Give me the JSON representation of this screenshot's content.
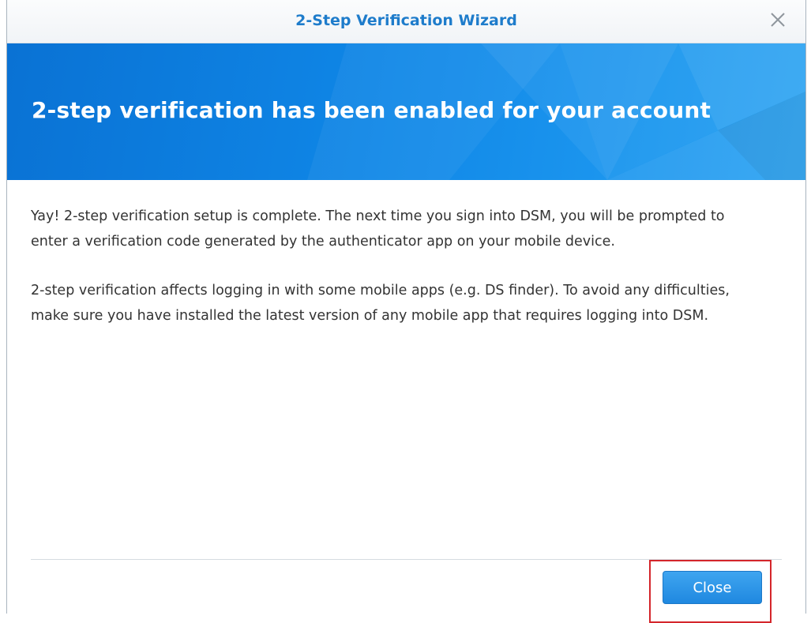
{
  "window": {
    "title": "2-Step Verification Wizard",
    "close_icon": "close-icon"
  },
  "banner": {
    "heading": "2-step verification has been enabled for your account"
  },
  "content": {
    "paragraphs": [
      "Yay! 2-step verification setup is complete. The next time you sign into DSM, you will be prompted to enter a verification code generated by the authenticator app on your mobile device.",
      "2-step verification affects logging in with some mobile apps (e.g. DS finder). To avoid any difficulties, make sure you have installed the latest version of any mobile app that requires logging into DSM."
    ]
  },
  "footer": {
    "close_label": "Close"
  },
  "colors": {
    "title": "#1e7ccb",
    "banner": "#0f86e6",
    "button": "#2a93e6",
    "highlight": "#d4262b"
  }
}
